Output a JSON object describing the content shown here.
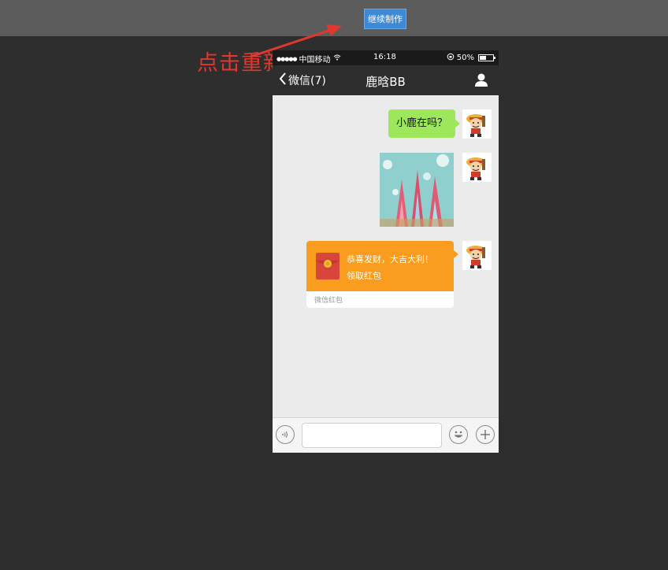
{
  "toolbar": {
    "continue_label": "继续制作"
  },
  "hint": {
    "text": "点击重新生成",
    "color": "#e2372f"
  },
  "status_bar": {
    "signal": "●●●●●",
    "carrier": "中国移动",
    "time": "16:18",
    "battery_text": "50%",
    "battery_level": 0.5
  },
  "nav": {
    "back_label": "微信(7)",
    "title": "鹿晗BB"
  },
  "messages": [
    {
      "type": "text",
      "text": "小鹿在吗？"
    },
    {
      "type": "image"
    },
    {
      "type": "red_packet",
      "line1": "恭喜发财，大吉大利！",
      "line2": "领取红包",
      "footer": "微信红包"
    }
  ],
  "input": {
    "value": "",
    "placeholder": ""
  },
  "colors": {
    "bubble_green": "#9ee65a",
    "red_packet_orange": "#fa9d1e",
    "nav_bg": "#2d2d2d",
    "button_blue": "#3f8ad6"
  }
}
